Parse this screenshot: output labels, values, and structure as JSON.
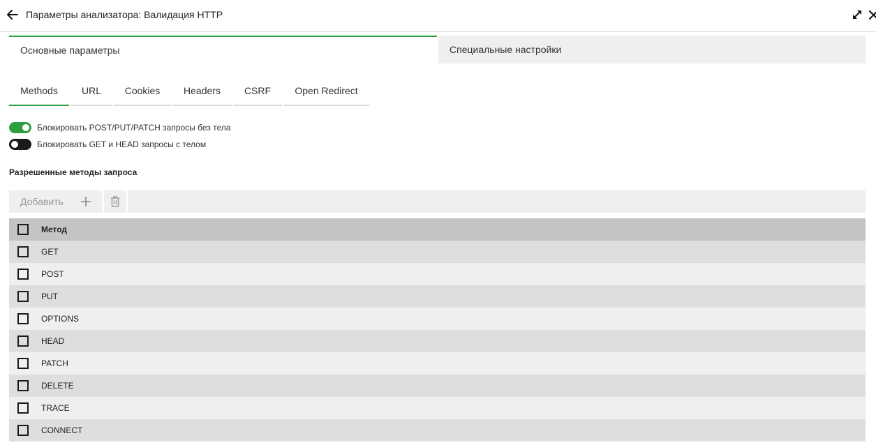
{
  "header": {
    "title": "Параметры анализатора: Валидация HTTP",
    "back_icon": "arrow-left-icon",
    "expand_icon": "expand-arrows-icon",
    "close_icon": "close-icon"
  },
  "main_tabs": [
    {
      "label": "Основные параметры",
      "active": true
    },
    {
      "label": "Специальные настройки",
      "active": false
    }
  ],
  "sub_tabs": [
    {
      "label": "Methods",
      "active": true
    },
    {
      "label": "URL",
      "active": false
    },
    {
      "label": "Cookies",
      "active": false
    },
    {
      "label": "Headers",
      "active": false
    },
    {
      "label": "CSRF",
      "active": false
    },
    {
      "label": "Open Redirect",
      "active": false
    }
  ],
  "toggles": [
    {
      "label": "Блокировать POST/PUT/PATCH запросы без тела",
      "on": true
    },
    {
      "label": "Блокировать GET и HEAD запросы с телом",
      "on": false
    }
  ],
  "section_title": "Разрешенные методы запроса",
  "toolbar": {
    "add_label": "Добавить",
    "add_icon": "plus-icon",
    "delete_icon": "trash-icon"
  },
  "table": {
    "header": "Метод",
    "rows": [
      "GET",
      "POST",
      "PUT",
      "OPTIONS",
      "HEAD",
      "PATCH",
      "DELETE",
      "TRACE",
      "CONNECT"
    ]
  },
  "colors": {
    "accent": "#2e9e3e",
    "toggle_off": "#1a1a1a",
    "header_row": "#c4c4c4",
    "row_odd": "#dedede",
    "row_even": "#efefef"
  }
}
